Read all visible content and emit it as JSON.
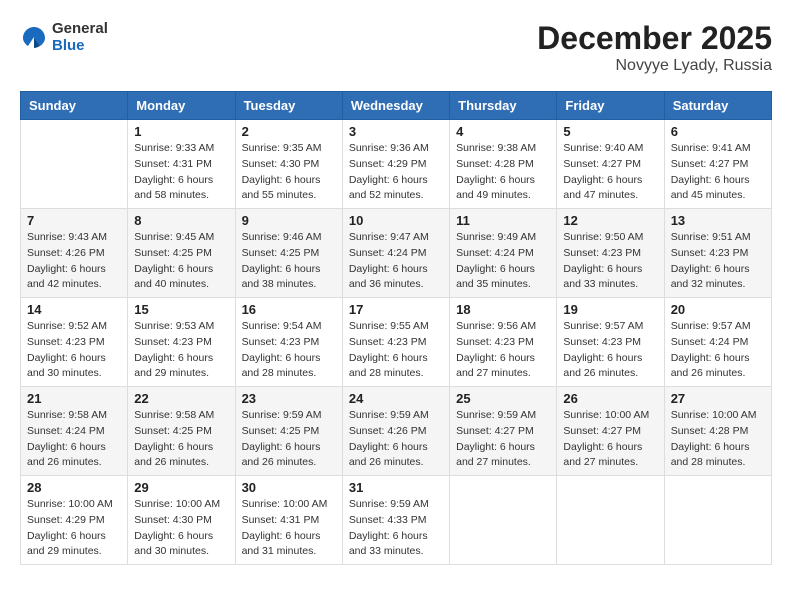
{
  "header": {
    "logo_general": "General",
    "logo_blue": "Blue",
    "month_year": "December 2025",
    "location": "Novyye Lyady, Russia"
  },
  "weekdays": [
    "Sunday",
    "Monday",
    "Tuesday",
    "Wednesday",
    "Thursday",
    "Friday",
    "Saturday"
  ],
  "weeks": [
    [
      {
        "day": "",
        "info": ""
      },
      {
        "day": "1",
        "info": "Sunrise: 9:33 AM\nSunset: 4:31 PM\nDaylight: 6 hours\nand 58 minutes."
      },
      {
        "day": "2",
        "info": "Sunrise: 9:35 AM\nSunset: 4:30 PM\nDaylight: 6 hours\nand 55 minutes."
      },
      {
        "day": "3",
        "info": "Sunrise: 9:36 AM\nSunset: 4:29 PM\nDaylight: 6 hours\nand 52 minutes."
      },
      {
        "day": "4",
        "info": "Sunrise: 9:38 AM\nSunset: 4:28 PM\nDaylight: 6 hours\nand 49 minutes."
      },
      {
        "day": "5",
        "info": "Sunrise: 9:40 AM\nSunset: 4:27 PM\nDaylight: 6 hours\nand 47 minutes."
      },
      {
        "day": "6",
        "info": "Sunrise: 9:41 AM\nSunset: 4:27 PM\nDaylight: 6 hours\nand 45 minutes."
      }
    ],
    [
      {
        "day": "7",
        "info": "Sunrise: 9:43 AM\nSunset: 4:26 PM\nDaylight: 6 hours\nand 42 minutes."
      },
      {
        "day": "8",
        "info": "Sunrise: 9:45 AM\nSunset: 4:25 PM\nDaylight: 6 hours\nand 40 minutes."
      },
      {
        "day": "9",
        "info": "Sunrise: 9:46 AM\nSunset: 4:25 PM\nDaylight: 6 hours\nand 38 minutes."
      },
      {
        "day": "10",
        "info": "Sunrise: 9:47 AM\nSunset: 4:24 PM\nDaylight: 6 hours\nand 36 minutes."
      },
      {
        "day": "11",
        "info": "Sunrise: 9:49 AM\nSunset: 4:24 PM\nDaylight: 6 hours\nand 35 minutes."
      },
      {
        "day": "12",
        "info": "Sunrise: 9:50 AM\nSunset: 4:23 PM\nDaylight: 6 hours\nand 33 minutes."
      },
      {
        "day": "13",
        "info": "Sunrise: 9:51 AM\nSunset: 4:23 PM\nDaylight: 6 hours\nand 32 minutes."
      }
    ],
    [
      {
        "day": "14",
        "info": "Sunrise: 9:52 AM\nSunset: 4:23 PM\nDaylight: 6 hours\nand 30 minutes."
      },
      {
        "day": "15",
        "info": "Sunrise: 9:53 AM\nSunset: 4:23 PM\nDaylight: 6 hours\nand 29 minutes."
      },
      {
        "day": "16",
        "info": "Sunrise: 9:54 AM\nSunset: 4:23 PM\nDaylight: 6 hours\nand 28 minutes."
      },
      {
        "day": "17",
        "info": "Sunrise: 9:55 AM\nSunset: 4:23 PM\nDaylight: 6 hours\nand 28 minutes."
      },
      {
        "day": "18",
        "info": "Sunrise: 9:56 AM\nSunset: 4:23 PM\nDaylight: 6 hours\nand 27 minutes."
      },
      {
        "day": "19",
        "info": "Sunrise: 9:57 AM\nSunset: 4:23 PM\nDaylight: 6 hours\nand 26 minutes."
      },
      {
        "day": "20",
        "info": "Sunrise: 9:57 AM\nSunset: 4:24 PM\nDaylight: 6 hours\nand 26 minutes."
      }
    ],
    [
      {
        "day": "21",
        "info": "Sunrise: 9:58 AM\nSunset: 4:24 PM\nDaylight: 6 hours\nand 26 minutes."
      },
      {
        "day": "22",
        "info": "Sunrise: 9:58 AM\nSunset: 4:25 PM\nDaylight: 6 hours\nand 26 minutes."
      },
      {
        "day": "23",
        "info": "Sunrise: 9:59 AM\nSunset: 4:25 PM\nDaylight: 6 hours\nand 26 minutes."
      },
      {
        "day": "24",
        "info": "Sunrise: 9:59 AM\nSunset: 4:26 PM\nDaylight: 6 hours\nand 26 minutes."
      },
      {
        "day": "25",
        "info": "Sunrise: 9:59 AM\nSunset: 4:27 PM\nDaylight: 6 hours\nand 27 minutes."
      },
      {
        "day": "26",
        "info": "Sunrise: 10:00 AM\nSunset: 4:27 PM\nDaylight: 6 hours\nand 27 minutes."
      },
      {
        "day": "27",
        "info": "Sunrise: 10:00 AM\nSunset: 4:28 PM\nDaylight: 6 hours\nand 28 minutes."
      }
    ],
    [
      {
        "day": "28",
        "info": "Sunrise: 10:00 AM\nSunset: 4:29 PM\nDaylight: 6 hours\nand 29 minutes."
      },
      {
        "day": "29",
        "info": "Sunrise: 10:00 AM\nSunset: 4:30 PM\nDaylight: 6 hours\nand 30 minutes."
      },
      {
        "day": "30",
        "info": "Sunrise: 10:00 AM\nSunset: 4:31 PM\nDaylight: 6 hours\nand 31 minutes."
      },
      {
        "day": "31",
        "info": "Sunrise: 9:59 AM\nSunset: 4:33 PM\nDaylight: 6 hours\nand 33 minutes."
      },
      {
        "day": "",
        "info": ""
      },
      {
        "day": "",
        "info": ""
      },
      {
        "day": "",
        "info": ""
      }
    ]
  ]
}
